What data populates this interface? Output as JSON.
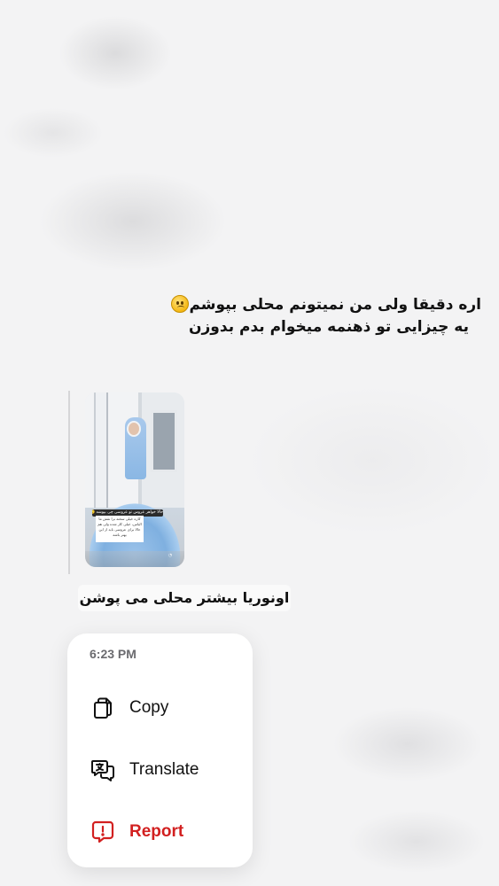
{
  "conversation": {
    "message": {
      "line1": "اره دقیقا ولی من نمیتونم محلی بپوشم",
      "line2": "یه چیزایی تو ذهنمه میخوام بدم بدوزن",
      "emoji": "slightly-frowning-face-emoji"
    },
    "shared_post": {
      "sticker_text": "حالا خواهر عروس تو عروسی چی بپوشه 🙂",
      "caption_text": "کاره خیلی سخته برا نقش ما الیاس، خیلی کار شده ولی هم حالا برای عروسی باید از این بهتر باشه"
    },
    "reply_caption": "اونوریا بیشتر محلی می پوشن"
  },
  "context_menu": {
    "timestamp": "6:23 PM",
    "items": [
      {
        "label": "Copy",
        "icon": "copy-icon",
        "color": "#111111"
      },
      {
        "label": "Translate",
        "icon": "translate-icon",
        "color": "#111111"
      },
      {
        "label": "Report",
        "icon": "report-icon",
        "color": "#d22020"
      }
    ]
  },
  "colors": {
    "backdrop": "#f3f3f4",
    "menu_background": "#ffffff",
    "report_red": "#d22020",
    "timestamp_gray": "#6b6b6f"
  }
}
